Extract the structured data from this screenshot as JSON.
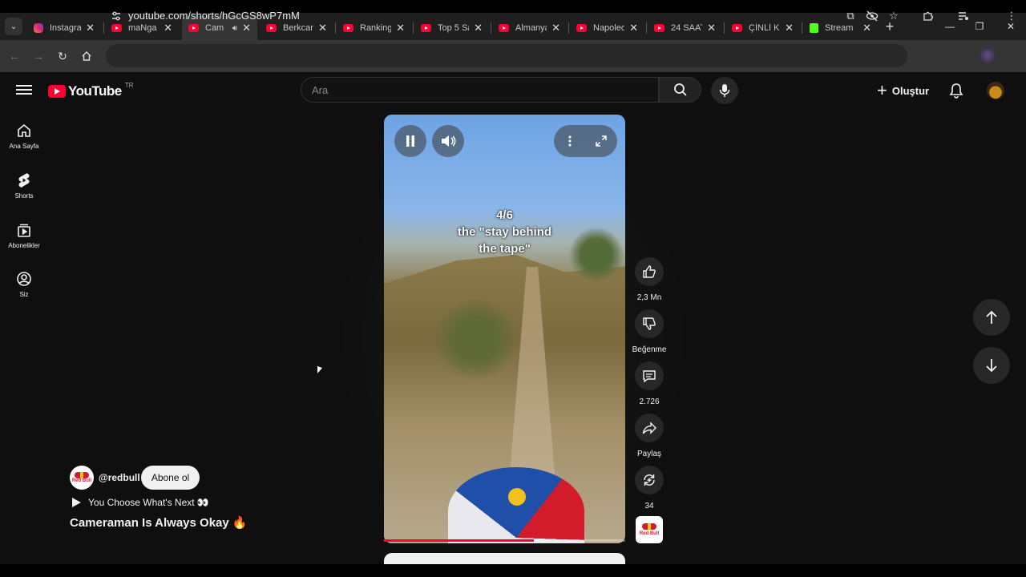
{
  "browser": {
    "tabs": [
      {
        "label": "Instagra",
        "favicon": "instagram-icon"
      },
      {
        "label": "maNga",
        "favicon": "youtube-icon"
      },
      {
        "label": "Cam",
        "favicon": "youtube-icon",
        "active": true,
        "audio": "speaker-icon"
      },
      {
        "label": "Berkcan",
        "favicon": "youtube-icon"
      },
      {
        "label": "Ranking",
        "favicon": "youtube-icon"
      },
      {
        "label": "Top 5 Sa",
        "favicon": "youtube-icon"
      },
      {
        "label": "Almanya",
        "favicon": "youtube-icon"
      },
      {
        "label": "Napoleo",
        "favicon": "youtube-icon"
      },
      {
        "label": "24 SAAT",
        "favicon": "youtube-icon"
      },
      {
        "label": "ÇİNLİ K",
        "favicon": "youtube-icon"
      },
      {
        "label": "Stream",
        "favicon": "kick-icon"
      }
    ],
    "close_glyph": "✕",
    "new_tab_glyph": "+",
    "url": "youtube.com/shorts/hGcGS8wP7mM"
  },
  "youtube": {
    "logo_text": "YouTube",
    "country_code": "TR",
    "search_placeholder": "Ara",
    "create_label": "Oluştur",
    "sidebar": [
      {
        "label": "Ana Sayfa",
        "icon": "home-icon"
      },
      {
        "label": "Shorts",
        "icon": "shorts-icon"
      },
      {
        "label": "Abonelikler",
        "icon": "subscriptions-icon"
      },
      {
        "label": "Siz",
        "icon": "you-icon"
      }
    ]
  },
  "short": {
    "overlay_counter": "4/6",
    "overlay_line1": "the \"stay behind",
    "overlay_line2": "the tape\"",
    "progress": 0.62,
    "actions": {
      "likes": "2,3 Mn",
      "dislike_label": "Beğenme",
      "comments": "2.726",
      "share_label": "Paylaş",
      "remix_count": "34"
    },
    "channel": {
      "handle": "@redbull",
      "subscribe_label": "Abone ol",
      "avatar_text": "Red Bull"
    },
    "playlist_label": "You Choose What's Next 👀",
    "title": "Cameraman Is Always Okay 🔥"
  },
  "colors": {
    "background": "#0f0f0f",
    "youtube_red": "#ff0033",
    "redbull_red": "#d21c2b"
  }
}
